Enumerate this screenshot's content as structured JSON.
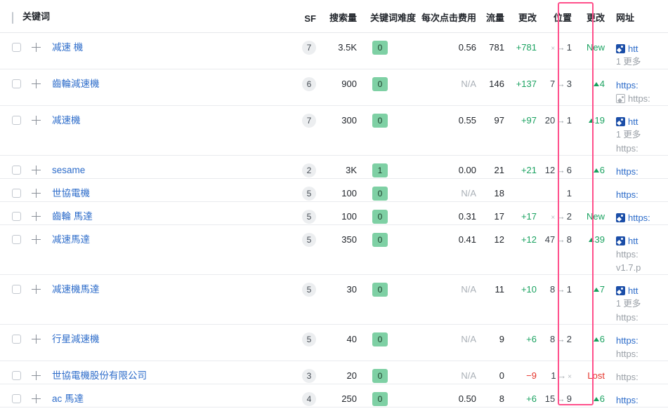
{
  "table": {
    "columns": [
      {
        "key": "keyword",
        "label": "关键词"
      },
      {
        "key": "sf",
        "label": "SF"
      },
      {
        "key": "volume",
        "label": "搜索量"
      },
      {
        "key": "kd",
        "label": "关键词难度"
      },
      {
        "key": "cpc",
        "label": "每次点击费用"
      },
      {
        "key": "traffic",
        "label": "流量"
      },
      {
        "key": "traffic_change",
        "label": "更改"
      },
      {
        "key": "position",
        "label": "位置"
      },
      {
        "key": "position_change",
        "label": "更改"
      },
      {
        "key": "url",
        "label": "网址"
      }
    ],
    "rows": [
      {
        "keyword": "减速 機",
        "sf": "7",
        "volume": "3.5K",
        "kd": "0",
        "cpc": "0.56",
        "cpc_na": false,
        "traffic": "781",
        "traffic_change": "+781",
        "traffic_change_dir": "up",
        "pos_from": "×",
        "pos_to": "1",
        "pos_has_arrow": true,
        "pos_change": "New",
        "pos_change_type": "new",
        "urls": [
          {
            "text": "htt",
            "style": "link",
            "icon": "serp-blue"
          },
          {
            "text": "1 更多",
            "style": "more"
          }
        ]
      },
      {
        "keyword": "齒輪減速機",
        "sf": "6",
        "volume": "900",
        "kd": "0",
        "cpc": "N/A",
        "cpc_na": true,
        "traffic": "146",
        "traffic_change": "+137",
        "traffic_change_dir": "up",
        "pos_from": "7",
        "pos_to": "3",
        "pos_has_arrow": true,
        "pos_change": "4",
        "pos_change_type": "up",
        "urls": [
          {
            "text": "https:",
            "style": "link"
          },
          {
            "text": "https:",
            "style": "gray",
            "icon": "serp-gray"
          }
        ]
      },
      {
        "keyword": "减速機",
        "sf": "7",
        "volume": "300",
        "kd": "0",
        "cpc": "0.55",
        "cpc_na": false,
        "traffic": "97",
        "traffic_change": "+97",
        "traffic_change_dir": "up",
        "pos_from": "20",
        "pos_to": "1",
        "pos_has_arrow": true,
        "pos_change": "19",
        "pos_change_type": "up",
        "urls": [
          {
            "text": "htt",
            "style": "link",
            "icon": "serp-blue"
          },
          {
            "text": "1 更多",
            "style": "more"
          },
          {
            "text": "https:",
            "style": "gray"
          }
        ]
      },
      {
        "keyword": "sesame",
        "sf": "2",
        "volume": "3K",
        "kd": "1",
        "cpc": "0.00",
        "cpc_na": false,
        "traffic": "21",
        "traffic_change": "+21",
        "traffic_change_dir": "up",
        "pos_from": "12",
        "pos_to": "6",
        "pos_has_arrow": true,
        "pos_change": "6",
        "pos_change_type": "up",
        "urls": [
          {
            "text": "https:",
            "style": "link"
          }
        ]
      },
      {
        "keyword": "世協電機",
        "sf": "5",
        "volume": "100",
        "kd": "0",
        "cpc": "N/A",
        "cpc_na": true,
        "traffic": "18",
        "traffic_change": "",
        "traffic_change_dir": "none",
        "pos_from": "",
        "pos_to": "1",
        "pos_has_arrow": false,
        "pos_change": "",
        "pos_change_type": "none",
        "urls": [
          {
            "text": "https:",
            "style": "link"
          }
        ]
      },
      {
        "keyword": "齒輪 馬達",
        "sf": "5",
        "volume": "100",
        "kd": "0",
        "cpc": "0.31",
        "cpc_na": false,
        "traffic": "17",
        "traffic_change": "+17",
        "traffic_change_dir": "up",
        "pos_from": "×",
        "pos_to": "2",
        "pos_has_arrow": true,
        "pos_change": "New",
        "pos_change_type": "new",
        "urls": [
          {
            "text": "https:",
            "style": "link",
            "icon": "serp-blue"
          }
        ]
      },
      {
        "keyword": "减速馬達",
        "sf": "5",
        "volume": "350",
        "kd": "0",
        "cpc": "0.41",
        "cpc_na": false,
        "traffic": "12",
        "traffic_change": "+12",
        "traffic_change_dir": "up",
        "pos_from": "47",
        "pos_to": "8",
        "pos_has_arrow": true,
        "pos_change": "39",
        "pos_change_type": "up",
        "urls": [
          {
            "text": "htt",
            "style": "link",
            "icon": "serp-blue"
          },
          {
            "text": "https:",
            "style": "gray"
          },
          {
            "text": "v1.7.p",
            "style": "gray"
          }
        ]
      },
      {
        "keyword": "减速機馬達",
        "sf": "5",
        "volume": "30",
        "kd": "0",
        "cpc": "N/A",
        "cpc_na": true,
        "traffic": "11",
        "traffic_change": "+10",
        "traffic_change_dir": "up",
        "pos_from": "8",
        "pos_to": "1",
        "pos_has_arrow": true,
        "pos_change": "7",
        "pos_change_type": "up",
        "urls": [
          {
            "text": "htt",
            "style": "link",
            "icon": "serp-blue"
          },
          {
            "text": "1 更多",
            "style": "more"
          },
          {
            "text": "https:",
            "style": "gray"
          }
        ]
      },
      {
        "keyword": "行星減速機",
        "sf": "5",
        "volume": "40",
        "kd": "0",
        "cpc": "N/A",
        "cpc_na": true,
        "traffic": "9",
        "traffic_change": "+6",
        "traffic_change_dir": "up",
        "pos_from": "8",
        "pos_to": "2",
        "pos_has_arrow": true,
        "pos_change": "6",
        "pos_change_type": "up",
        "urls": [
          {
            "text": "https:",
            "style": "link"
          },
          {
            "text": "https:",
            "style": "gray"
          }
        ]
      },
      {
        "keyword": "世協電機股份有限公司",
        "sf": "3",
        "volume": "20",
        "kd": "0",
        "cpc": "N/A",
        "cpc_na": true,
        "traffic": "0",
        "traffic_change": "−9",
        "traffic_change_dir": "down",
        "pos_from": "1",
        "pos_to": "×",
        "pos_has_arrow": true,
        "pos_change": "Lost",
        "pos_change_type": "lost",
        "urls": [
          {
            "text": "https:",
            "style": "gray"
          }
        ]
      },
      {
        "keyword": "ac 馬達",
        "sf": "4",
        "volume": "250",
        "kd": "0",
        "cpc": "0.50",
        "cpc_na": false,
        "traffic": "8",
        "traffic_change": "+6",
        "traffic_change_dir": "up",
        "pos_from": "15",
        "pos_to": "9",
        "pos_has_arrow": true,
        "pos_change": "6",
        "pos_change_type": "up",
        "urls": [
          {
            "text": "https:",
            "style": "link"
          }
        ]
      }
    ]
  },
  "highlight": {
    "label": "position-column-highlight",
    "color": "#ff4f8b"
  }
}
